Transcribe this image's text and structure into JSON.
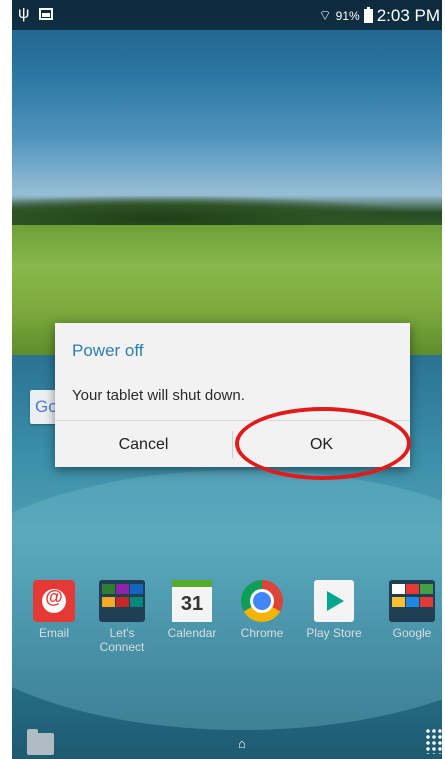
{
  "status_bar": {
    "left_icons": [
      "usb-icon",
      "image-icon"
    ],
    "wifi_icon": "wifi-icon",
    "battery_percent": "91%",
    "time": "2:03 PM"
  },
  "google_bar": {
    "text": "Go"
  },
  "dialog": {
    "title": "Power off",
    "message": "Your tablet will shut down.",
    "cancel_label": "Cancel",
    "ok_label": "OK"
  },
  "annotation": {
    "color": "#e11a1a",
    "target": "OK"
  },
  "apps": [
    {
      "label": "Email",
      "icon": "email-icon"
    },
    {
      "label": "Let's Connect",
      "icon": "folder-icon"
    },
    {
      "label": "Calendar",
      "icon": "calendar-icon",
      "day": "31"
    },
    {
      "label": "Chrome",
      "icon": "chrome-icon"
    },
    {
      "label": "Play Store",
      "icon": "play-store-icon"
    },
    {
      "label": "Google",
      "icon": "folder-icon"
    }
  ],
  "dock": {
    "left_icon": "folder-icon",
    "center_icon": "home-icon",
    "right_icon": "apps-grid-icon"
  },
  "colors": {
    "dialog_title": "#2c7fb1",
    "accent_red": "#e11a1a"
  }
}
